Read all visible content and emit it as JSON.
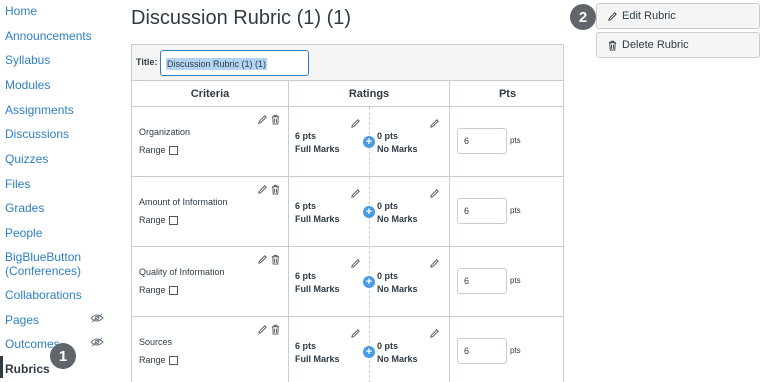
{
  "sidebar": {
    "items": [
      {
        "label": "Home"
      },
      {
        "label": "Announcements"
      },
      {
        "label": "Syllabus"
      },
      {
        "label": "Modules"
      },
      {
        "label": "Assignments"
      },
      {
        "label": "Discussions"
      },
      {
        "label": "Quizzes"
      },
      {
        "label": "Files"
      },
      {
        "label": "Grades"
      },
      {
        "label": "People"
      },
      {
        "label": "BigBlueButton (Conferences)"
      },
      {
        "label": "Collaborations"
      },
      {
        "label": "Pages"
      },
      {
        "label": "Outcomes"
      },
      {
        "label": "Rubrics"
      }
    ],
    "active_item": "Rubrics",
    "hidden_items": [
      "Pages",
      "Outcomes"
    ]
  },
  "callouts": {
    "step1": "1",
    "step2": "2"
  },
  "page": {
    "title": "Discussion Rubric (1) (1)"
  },
  "actions": {
    "edit_label": "Edit Rubric",
    "delete_label": "Delete Rubric"
  },
  "rubric": {
    "title_label": "Title:",
    "title_value": "Discussion Rubric (1) (1)",
    "headers": {
      "criteria": "Criteria",
      "ratings": "Ratings",
      "pts": "Pts"
    },
    "range_label": "Range",
    "pts_unit": "pts",
    "criteria": [
      {
        "name": "Organization",
        "rating_high_pts": "6 pts",
        "rating_high_desc": "Full Marks",
        "rating_low_pts": "0 pts",
        "rating_low_desc": "No Marks",
        "points": "6"
      },
      {
        "name": "Amount of Information",
        "rating_high_pts": "6 pts",
        "rating_high_desc": "Full Marks",
        "rating_low_pts": "0 pts",
        "rating_low_desc": "No Marks",
        "points": "6"
      },
      {
        "name": "Quality of Information",
        "rating_high_pts": "6 pts",
        "rating_high_desc": "Full Marks",
        "rating_low_pts": "0 pts",
        "rating_low_desc": "No Marks",
        "points": "6"
      },
      {
        "name": "Sources",
        "rating_high_pts": "6 pts",
        "rating_high_desc": "Full Marks",
        "rating_low_pts": "0 pts",
        "rating_low_desc": "No Marks",
        "points": "6"
      }
    ]
  },
  "colors": {
    "link": "#2d7fc2",
    "text": "#2d3b45",
    "badge": "#5f6568",
    "add_rating": "#4a9be0"
  }
}
